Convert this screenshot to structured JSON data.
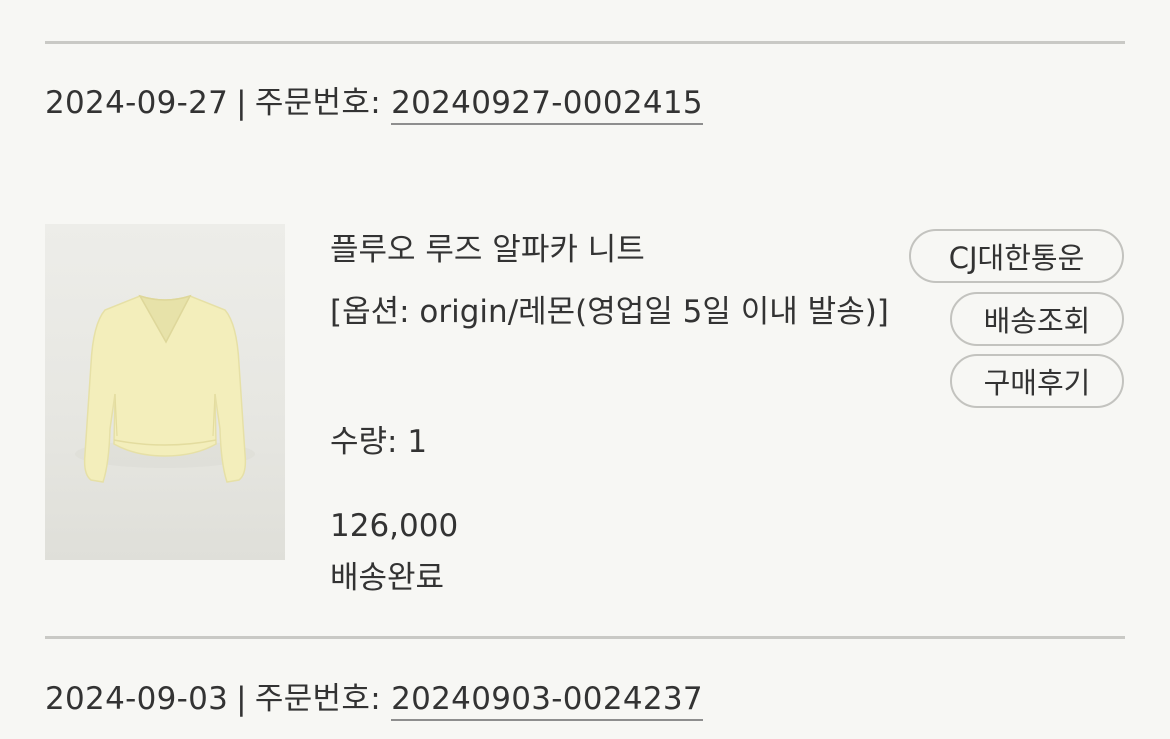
{
  "orders": [
    {
      "date": "2024-09-27",
      "separator": "|",
      "order_label": "주문번호:",
      "order_number": "20240927-0002415",
      "item": {
        "image_icon": "yellow-v-neck-knit-sweater",
        "name": "플루오 루즈 알파카 니트",
        "option": "[옵션: origin/레몬(영업일 5일 이내 발송)]",
        "quantity": "수량: 1",
        "price": "126,000",
        "status": "배송완료"
      },
      "buttons": {
        "courier": "CJ대한통운",
        "track": "배송조회",
        "review": "구매후기"
      }
    },
    {
      "date": "2024-09-03",
      "separator": "|",
      "order_label": "주문번호:",
      "order_number": "20240903-0024237"
    }
  ],
  "colors": {
    "background": "#f7f7f4",
    "text": "#333333",
    "divider": "#c9c9c5",
    "button_border": "#c3c3bf",
    "sweater": "#f3eebb"
  }
}
